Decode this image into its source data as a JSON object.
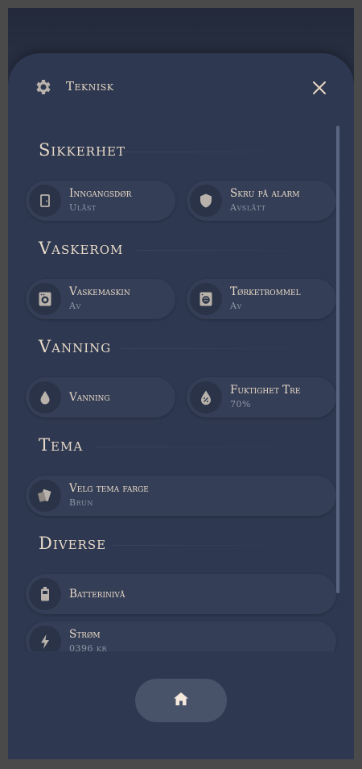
{
  "header": {
    "title": "Teknisk"
  },
  "sections": [
    {
      "title": "Sikkerhet",
      "tiles": [
        {
          "name": "Inngangsdør",
          "state": "Ulåst",
          "icon": "door-icon"
        },
        {
          "name": "Skru på alarm",
          "state": "Avslått",
          "icon": "shield-icon"
        }
      ]
    },
    {
      "title": "Vaskerom",
      "tiles": [
        {
          "name": "Vaskemaskin",
          "state": "Av",
          "icon": "washing-machine-icon"
        },
        {
          "name": "Tørketrommel",
          "state": "Av",
          "icon": "tumble-dryer-icon"
        }
      ]
    },
    {
      "title": "Vanning",
      "tiles": [
        {
          "name": "Vanning",
          "state": "",
          "icon": "water-drop-icon"
        },
        {
          "name": "Fuktighet Tre",
          "state": "70%",
          "icon": "humidity-icon"
        }
      ]
    },
    {
      "title": "Tema",
      "tiles": [
        {
          "name": "Velg tema farge",
          "state": "Brun",
          "icon": "palette-icon"
        }
      ]
    },
    {
      "title": "Diverse",
      "tiles": [
        {
          "name": "Batterinivå",
          "state": "",
          "icon": "battery-icon"
        },
        {
          "name": "Strøm",
          "state": "0396 kr",
          "icon": "lightning-icon"
        }
      ]
    }
  ],
  "nav": {
    "home_icon": "home-icon"
  },
  "colors": {
    "accent_text": "#eadbc9",
    "panel_bg": "#2e3850",
    "icon_color": "#b8b2ab"
  }
}
